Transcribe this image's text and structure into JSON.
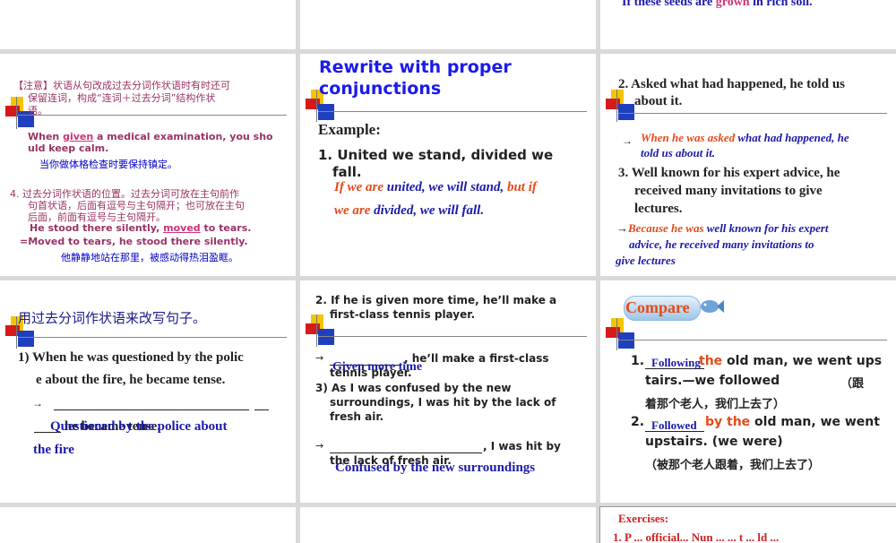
{
  "s_top3": {
    "line": "If these seeds are grown in rich soil.",
    "p1": "If these seeds are ",
    "hl": "grown",
    "p2": " in rich soil."
  },
  "s1": {
    "note1": "【注意】状语从句改成过去分词作状语时有时还可",
    "note2": "保留连词，构成“连词＋过去分词”结构作状",
    "note3": "语。",
    "ex1_a": "When ",
    "ex1_hl": "given",
    "ex1_b": " a medical examination, you sho",
    "ex1_c": "uld keep calm.",
    "ex1_cn": "当你做体格检查时要保持镇定。",
    "pt4_1": "4.  过去分词作状语的位置。过去分词可放在主句前作",
    "pt4_2": "句首状语，后面有逗号与主句隔开；也可放在主句",
    "pt4_3": "后面，前面有逗号与主句隔开。",
    "ex2_a": "He stood there silently, ",
    "ex2_hl": "moved",
    "ex2_b": " to tears.",
    "ex2_alt": "=Moved to tears, he stood there silently.",
    "ex2_cn": "他静静地站在那里，被感动得热泪盈眶。"
  },
  "s2": {
    "title1": "Rewrite with proper",
    "title2": "conjunctions",
    "example": "Example:",
    "item1_a": "1. United we stand, divided we",
    "item1_b": "fall.",
    "ans1_c1": "If we are",
    "ans1_t1": " united, we will stand, ",
    "ans1_c2": "but if",
    "ans1_c3": "we are",
    "ans1_t2": " divided, we will fall."
  },
  "s3": {
    "q2_a": "2. Asked what had happened, he told us",
    "q2_b": "about it.",
    "arrow": "→",
    "a2_c": "When he was asked",
    "a2_t1": " what had happened, he",
    "a2_t2": "told us about it.",
    "q3_a": "3. Well known for his expert advice, he",
    "q3_b": "received many invitations to give",
    "q3_c": "lectures.",
    "a3_arrow": "→",
    "a3_c": "Because he was",
    "a3_t1": " well known for his expert",
    "a3_t2": "advice, he received many invitations to",
    "a3_t3": "give lectures"
  },
  "s4": {
    "title": "用过去分词作状语来改写句子。",
    "q1_a": "1) When he was questioned by the polic",
    "q1_b": "e about the fire, he became tense.",
    "arrow": "→",
    "blank_tail": "he became tense.",
    "ans_a": "Questioned by the police about",
    "ans_b": "the fire"
  },
  "s5": {
    "q2_a": "2. If he is given more time, he’ll make a",
    "q2_b": "first-class tennis player.",
    "arrow": "→",
    "blank2_tail": ", he’ll make a first-class",
    "blank2_tail2": "tennis player.",
    "ans2": "Given more time",
    "q3_a": "3) As I was confused by the new",
    "q3_b": "surroundings, I was hit by the lack of",
    "q3_c": "fresh air.",
    "blank3_tail": ", I was hit by",
    "blank3_tail2": "the lack of fresh air.",
    "ans3": "Confused by the new surroundings"
  },
  "s6": {
    "title": "Compare",
    "i1_num": "1.",
    "i1_fill": "Following",
    "i1_over": "the",
    "i1_a": " old man, we went ups",
    "i1_b": "tairs.—we followed",
    "i1_c": "（跟",
    "i1_d": "着那个老人，我们上去了）",
    "i2_num": "2.",
    "i2_fill": "Followed",
    "i2_over": "by the",
    "i2_a": " old man, we went",
    "i2_b": "upstairs. (we were)",
    "i2_c": "（被那个老人跟着，我们上去了）"
  },
  "s_bot3": {
    "title": "Exercises:",
    "line": "1.    P  ...  official...  Nun ...    ... t  ... ld ..."
  },
  "colors": {
    "purple": "#993366",
    "blue": "#1a1aaa",
    "orange": "#e64a19",
    "pink": "#cc3377"
  }
}
